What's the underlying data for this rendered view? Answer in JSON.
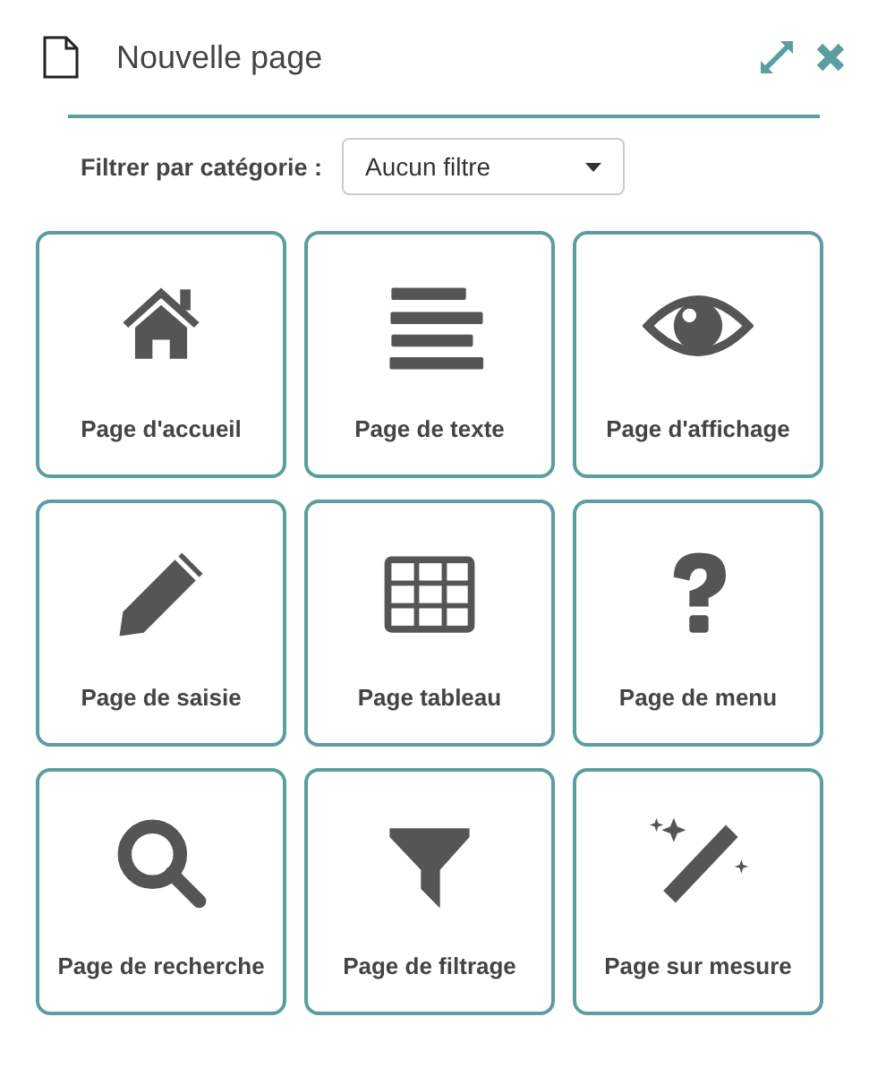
{
  "window": {
    "title": "Nouvelle page"
  },
  "filter": {
    "label": "Filtrer par catégorie :",
    "value": "Aucun filtre"
  },
  "tiles": [
    {
      "kind": "home",
      "label": "Page d'accueil"
    },
    {
      "kind": "text",
      "label": "Page de texte"
    },
    {
      "kind": "eye",
      "label": "Page d'affichage"
    },
    {
      "kind": "pencil",
      "label": "Page de saisie"
    },
    {
      "kind": "table",
      "label": "Page tableau"
    },
    {
      "kind": "question",
      "label": "Page de menu"
    },
    {
      "kind": "search",
      "label": "Page de recherche"
    },
    {
      "kind": "filter",
      "label": "Page de filtrage"
    },
    {
      "kind": "wand",
      "label": "Page sur mesure"
    }
  ]
}
